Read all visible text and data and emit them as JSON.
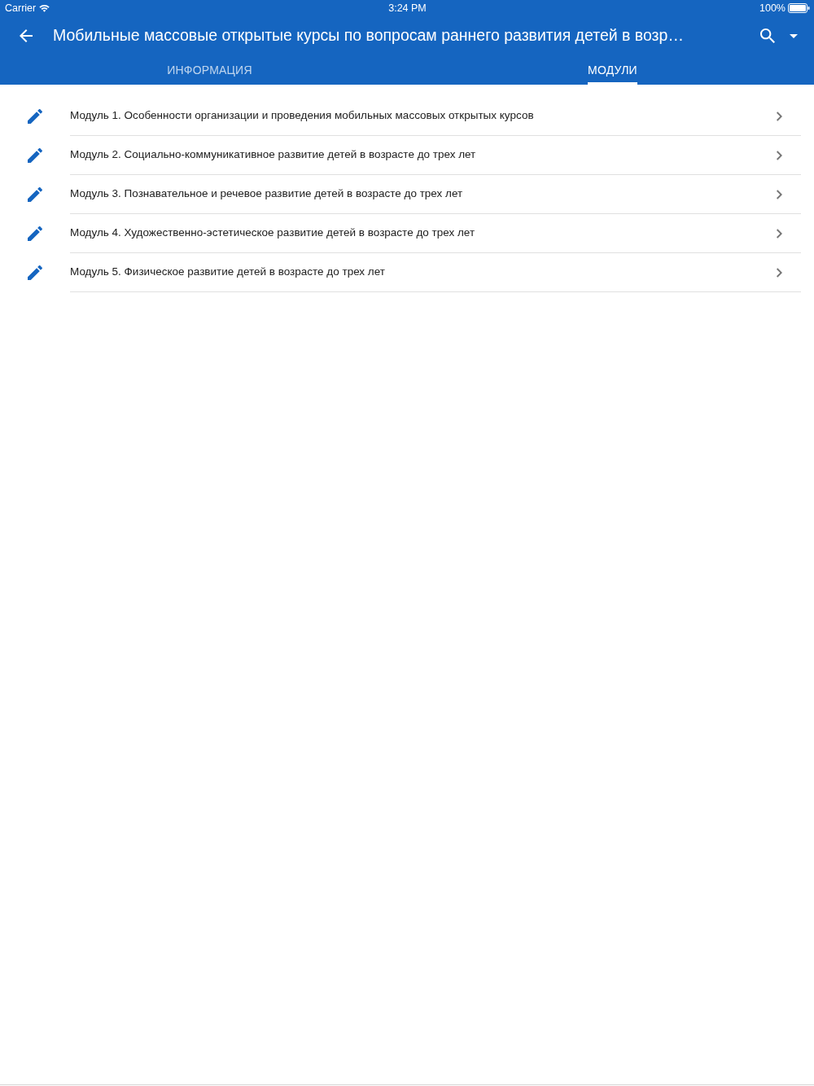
{
  "status_bar": {
    "carrier": "Carrier",
    "time": "3:24 PM",
    "battery": "100%"
  },
  "toolbar": {
    "title": "Мобильные массовые открытые курсы по вопросам раннего развития детей в возр…"
  },
  "tabs": [
    {
      "label": "ИНФОРМАЦИЯ",
      "selected": false
    },
    {
      "label": "МОДУЛИ",
      "selected": true
    }
  ],
  "modules": [
    {
      "title": "Модуль 1. Особенности организации и проведения мобильных массовых открытых курсов"
    },
    {
      "title": "Модуль 2. Социально-коммуникативное развитие детей в возрасте до трех лет"
    },
    {
      "title": "Модуль 3. Познавательное и речевое развитие детей в возрасте до трех лет"
    },
    {
      "title": "Модуль 4. Художественно-эстетическое развитие детей в возрасте до трех лет"
    },
    {
      "title": "Модуль 5. Физическое развитие детей в возрасте до трех лет"
    }
  ]
}
